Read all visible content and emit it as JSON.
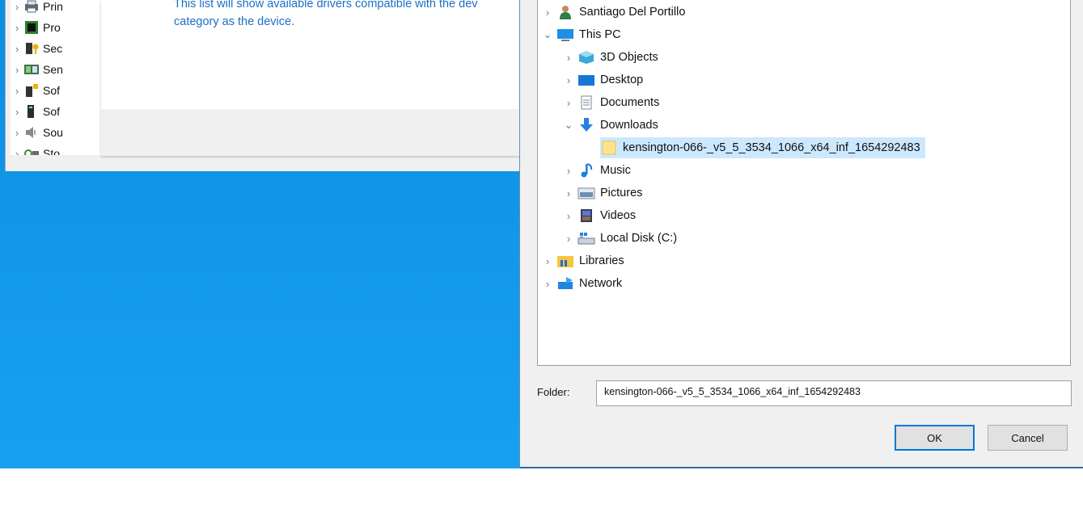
{
  "device_manager": {
    "tree_items": [
      {
        "label": "Prin",
        "icon": "printer-icon"
      },
      {
        "label": "Pro",
        "icon": "processor-icon"
      },
      {
        "label": "Sec",
        "icon": "security-device-icon"
      },
      {
        "label": "Sen",
        "icon": "sensor-icon"
      },
      {
        "label": "Sof",
        "icon": "software-component-icon"
      },
      {
        "label": "Sof",
        "icon": "software-device-icon"
      },
      {
        "label": "Sou",
        "icon": "sound-icon"
      },
      {
        "label": "Sto",
        "icon": "storage-icon"
      }
    ]
  },
  "wizard": {
    "line1": "This list will show available drivers compatible with the dev",
    "line2": "category as the device."
  },
  "browse_dialog": {
    "tree": {
      "user": "Santiago Del Portillo",
      "this_pc": "This PC",
      "objects_3d": "3D Objects",
      "desktop": "Desktop",
      "documents": "Documents",
      "downloads": "Downloads",
      "selected_folder": "kensington-066-_v5_5_3534_1066_x64_inf_1654292483",
      "music": "Music",
      "pictures": "Pictures",
      "videos": "Videos",
      "local_disk": "Local Disk (C:)",
      "libraries": "Libraries",
      "network": "Network"
    },
    "folder_label": "Folder:",
    "folder_value": "kensington-066-_v5_5_3534_1066_x64_inf_1654292483",
    "ok_label": "OK",
    "cancel_label": "Cancel"
  },
  "colors": {
    "desktop": "#0a8fe0",
    "link_text": "#1a6fc4",
    "selection": "#cce8ff",
    "default_button_border": "#0078d7"
  }
}
